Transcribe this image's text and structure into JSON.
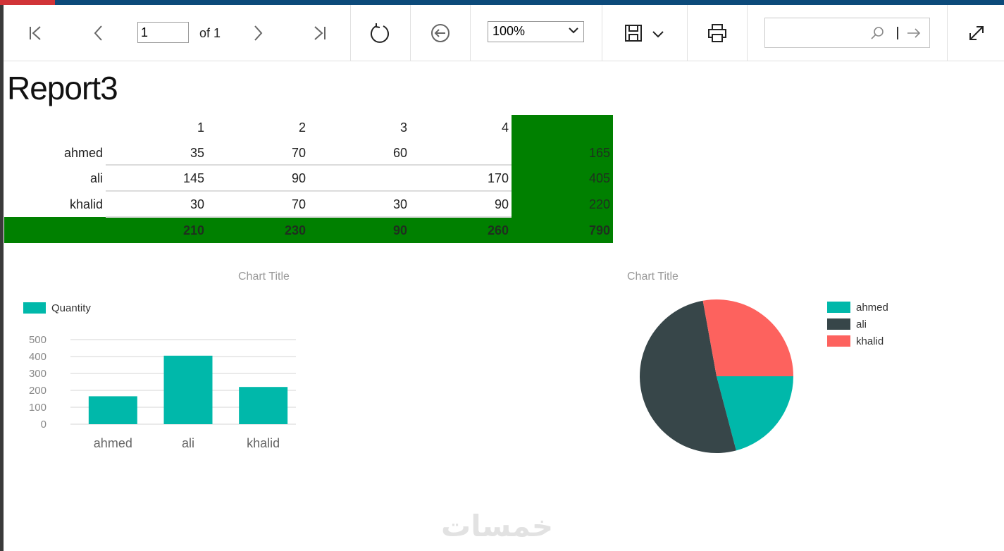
{
  "toolbar": {
    "page_current": "1",
    "page_of": "of 1",
    "zoom": "100%",
    "search_placeholder": ""
  },
  "report": {
    "title": "Report3",
    "columns": [
      "1",
      "2",
      "3",
      "4",
      ""
    ],
    "rows": [
      {
        "name": "ahmed",
        "values": [
          "35",
          "70",
          "60",
          "",
          "165"
        ]
      },
      {
        "name": "ali",
        "values": [
          "145",
          "90",
          "",
          "170",
          "405"
        ]
      },
      {
        "name": "khalid",
        "values": [
          "30",
          "70",
          "30",
          "90",
          "220"
        ]
      }
    ],
    "totals": [
      "210",
      "230",
      "90",
      "260",
      "790"
    ]
  },
  "chart_data": [
    {
      "type": "bar",
      "title": "Chart Title",
      "categories": [
        "ahmed",
        "ali",
        "khalid"
      ],
      "series": [
        {
          "name": "Quantity",
          "values": [
            165,
            405,
            220
          ]
        }
      ],
      "yticks": [
        "500",
        "400",
        "300",
        "200",
        "100",
        "0"
      ],
      "ylim": [
        0,
        500
      ],
      "legend": "top-left",
      "color": "#00b8aa"
    },
    {
      "type": "pie",
      "title": "Chart Title",
      "categories": [
        "ahmed",
        "ali",
        "khalid"
      ],
      "values": [
        165,
        405,
        220
      ],
      "colors": [
        "#00b8aa",
        "#374649",
        "#fd625e"
      ],
      "legend": "right"
    }
  ],
  "watermark": "خمسات",
  "colors": {
    "accent": "#0c4a7a",
    "total_fill": "#008000"
  }
}
